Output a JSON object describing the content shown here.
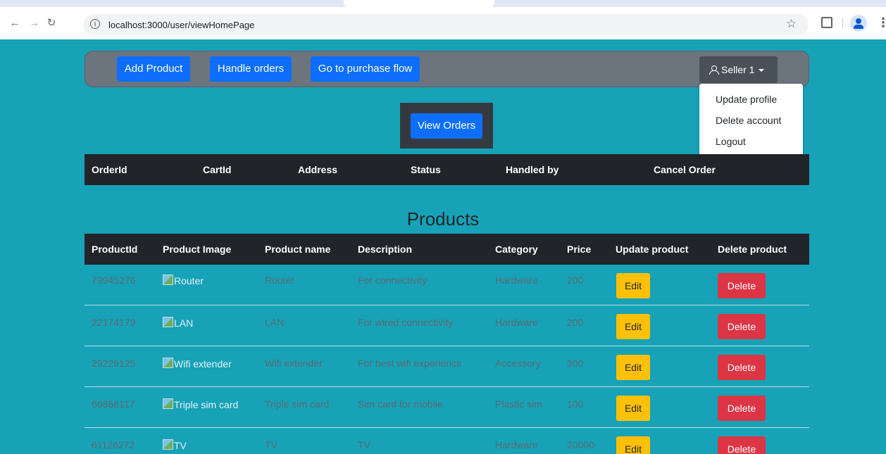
{
  "browser": {
    "url": "localhost:3000/user/viewHomePage"
  },
  "navbar": {
    "add_product": "Add Product",
    "handle_orders": "Handle orders",
    "purchase_flow": "Go to purchase flow",
    "user_label": "Seller 1"
  },
  "dropdown": {
    "items": [
      "Update profile",
      "Delete account",
      "Logout"
    ]
  },
  "orders": {
    "view_button": "View Orders",
    "columns": [
      "OrderId",
      "CartId",
      "Address",
      "Status",
      "Handled by",
      "Cancel Order"
    ]
  },
  "products": {
    "title": "Products",
    "columns": [
      "ProductId",
      "Product Image",
      "Product name",
      "Description",
      "Category",
      "Price",
      "Update product",
      "Delete product"
    ],
    "edit_label": "Edit",
    "delete_label": "Delete",
    "rows": [
      {
        "id": "79945276",
        "image_alt": "Router",
        "name": "Router",
        "description": "For connectivity",
        "category": "Hardware",
        "price": "200"
      },
      {
        "id": "22174179",
        "image_alt": "LAN",
        "name": "LAN",
        "description": "For wired connectivity",
        "category": "Hardware",
        "price": "200"
      },
      {
        "id": "29229125",
        "image_alt": "Wifi extender",
        "name": "Wifi extender",
        "description": "For best wifi experience",
        "category": "Accessory",
        "price": "300"
      },
      {
        "id": "66868117",
        "image_alt": "Triple sim card",
        "name": "Triple sim card",
        "description": "Sim card for mobile",
        "category": "Plastic sim",
        "price": "100"
      },
      {
        "id": "61126272",
        "image_alt": "TV",
        "name": "TV",
        "description": "TV",
        "category": "Hardware",
        "price": "20000"
      }
    ]
  }
}
